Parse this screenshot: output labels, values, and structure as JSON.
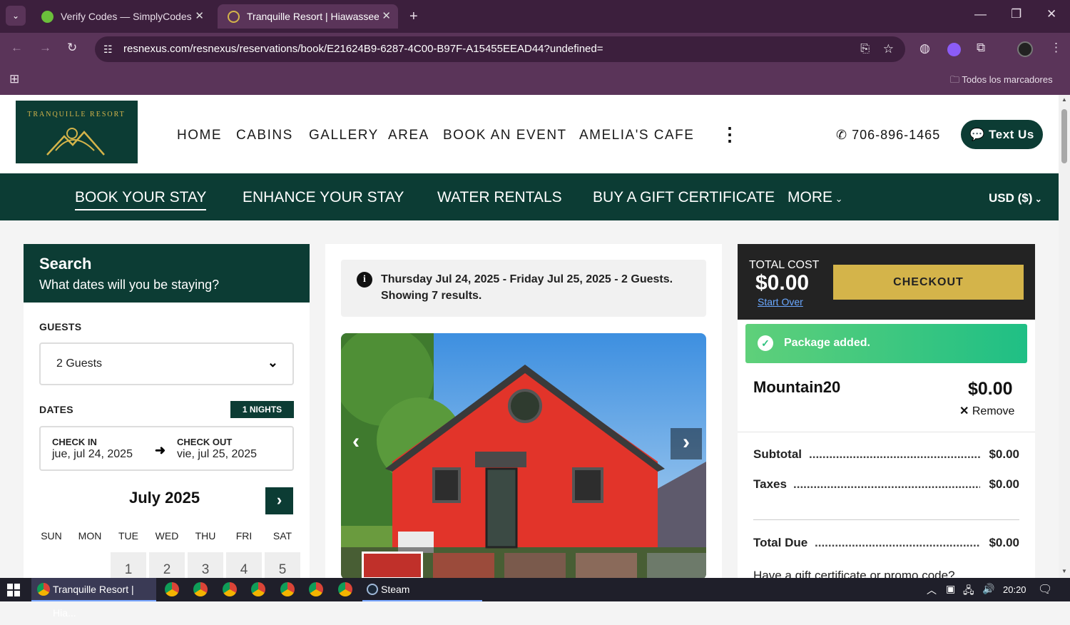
{
  "browser": {
    "tabs": [
      {
        "title": "Verify Codes — SimplyCodes",
        "active": false
      },
      {
        "title": "Tranquille Resort | Hiawassee, G",
        "active": true
      }
    ],
    "url": "resnexus.com/resnexus/reservations/book/E21624B9-6287-4C00-B97F-A15455EEAD44?undefined=",
    "bookmarks_label": "Todos los marcadores"
  },
  "site": {
    "logo_text": "TRANQUILLE RESORT",
    "nav": [
      "HOME",
      "CABINS",
      "GALLERY",
      "AREA",
      "BOOK AN EVENT",
      "AMELIA'S CAFE"
    ],
    "phone": "706-896-1465",
    "text_us": "Text Us",
    "subnav": [
      "BOOK YOUR STAY",
      "ENHANCE YOUR STAY",
      "WATER RENTALS",
      "BUY A GIFT CERTIFICATE"
    ],
    "more": "MORE",
    "currency": "USD ($)"
  },
  "search": {
    "title": "Search",
    "subtitle": "What dates will you be staying?",
    "guests_label": "GUESTS",
    "guests_value": "2 Guests",
    "dates_label": "DATES",
    "nights_badge": "1 NIGHTS",
    "checkin_label": "CHECK IN",
    "checkin_value": "jue, jul 24, 2025",
    "checkout_label": "CHECK OUT",
    "checkout_value": "vie, jul 25, 2025",
    "calendar_month": "July 2025",
    "weekdays": [
      "SUN",
      "MON",
      "TUE",
      "WED",
      "THU",
      "FRI",
      "SAT"
    ],
    "first_row": [
      "1",
      "2",
      "3",
      "4",
      "5"
    ]
  },
  "results": {
    "info_line1": "Thursday Jul 24, 2025 - Friday Jul 25, 2025 - 2 Guests.",
    "info_line2": "Showing 7 results."
  },
  "cart": {
    "total_cost_label": "TOTAL COST",
    "total_cost": "$0.00",
    "start_over": "Start Over",
    "checkout": "CHECKOUT",
    "alert": "Package added.",
    "package_name": "Mountain20",
    "package_price": "$0.00",
    "remove": "Remove",
    "subtotal_label": "Subtotal",
    "subtotal": "$0.00",
    "taxes_label": "Taxes",
    "taxes": "$0.00",
    "total_due_label": "Total Due",
    "total_due": "$0.00",
    "promo": "Have a gift certificate or promo code?"
  },
  "taskbar": {
    "active_window": "Tranquille Resort | Hia...",
    "steam": "Steam",
    "time": "20:20"
  },
  "colors": {
    "brand": "#0c3c34",
    "gold": "#d4b44a",
    "success": "#2ec27e"
  }
}
